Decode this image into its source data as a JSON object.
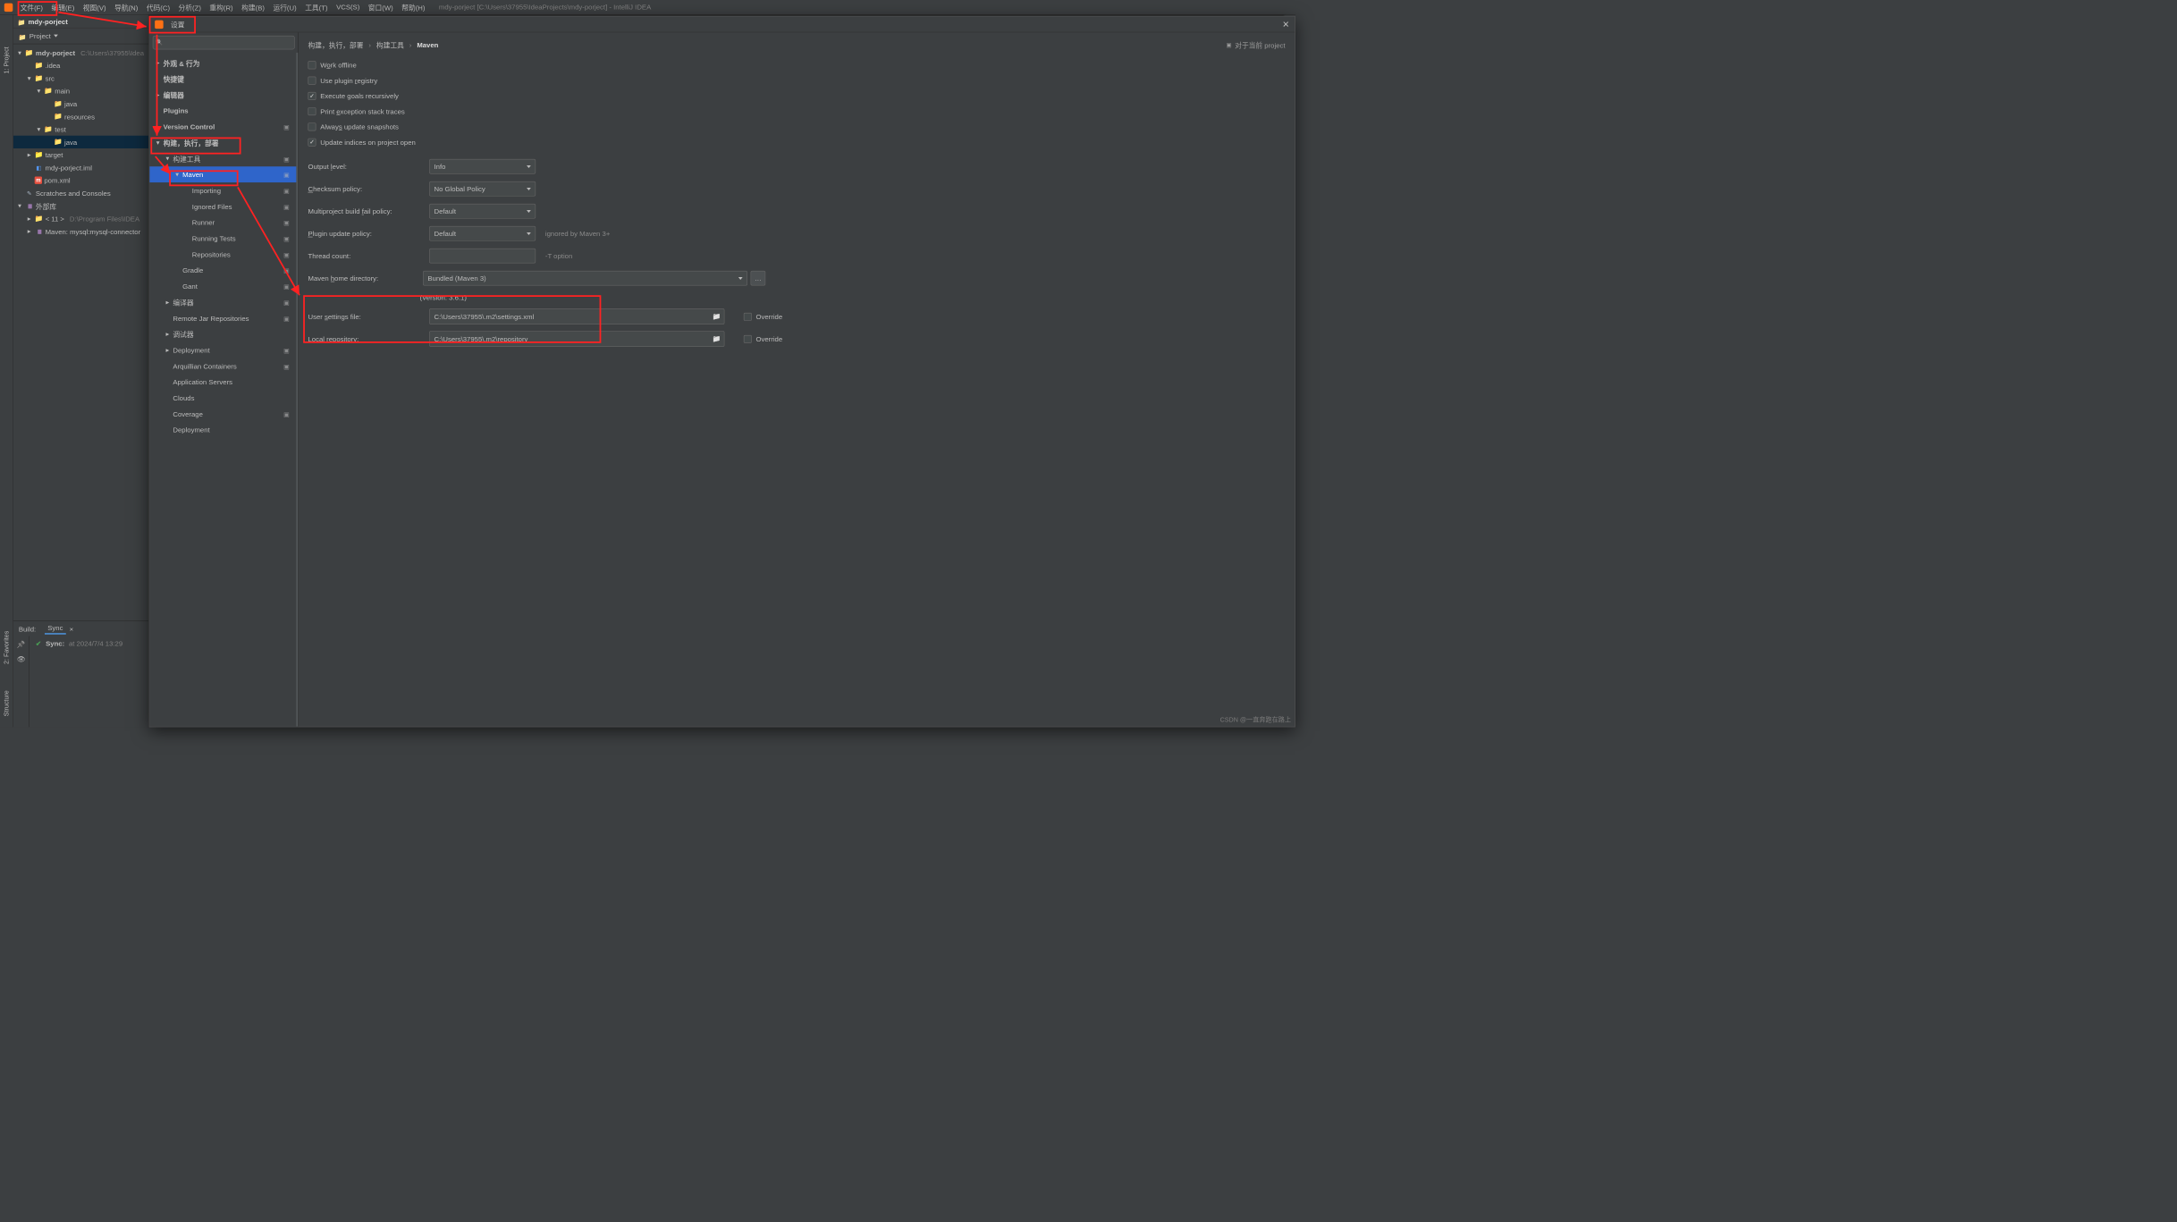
{
  "menubar": {
    "items": [
      "文件(F)",
      "编辑(E)",
      "视图(V)",
      "导航(N)",
      "代码(C)",
      "分析(Z)",
      "重构(R)",
      "构建(B)",
      "运行(U)",
      "工具(T)",
      "VCS(S)",
      "窗口(W)",
      "帮助(H)"
    ],
    "window_title": "mdy-porject [C:\\Users\\37955\\IdeaProjects\\mdy-porject] - IntelliJ IDEA"
  },
  "crumb": {
    "project": "mdy-porject"
  },
  "project_pane": {
    "header": "Project",
    "root_name": "mdy-porject",
    "root_path": "C:\\Users\\37955\\Idea",
    "nodes": [
      {
        "l": ".idea",
        "d": 1,
        "tw": "none",
        "ico": "folder"
      },
      {
        "l": "src",
        "d": 1,
        "tw": "open",
        "ico": "folder"
      },
      {
        "l": "main",
        "d": 2,
        "tw": "open",
        "ico": "folder"
      },
      {
        "l": "java",
        "d": 3,
        "tw": "none",
        "ico": "folder"
      },
      {
        "l": "resources",
        "d": 3,
        "tw": "none",
        "ico": "folder"
      },
      {
        "l": "test",
        "d": 2,
        "tw": "open",
        "ico": "folder"
      },
      {
        "l": "java",
        "d": 3,
        "tw": "none",
        "ico": "folder",
        "sel": true
      },
      {
        "l": "target",
        "d": 1,
        "tw": "closed",
        "ico": "orange-folder"
      },
      {
        "l": "mdy-porject.iml",
        "d": 1,
        "tw": "none",
        "ico": "module"
      },
      {
        "l": "pom.xml",
        "d": 1,
        "tw": "none",
        "ico": "maven"
      }
    ],
    "scratches": "Scratches and Consoles",
    "ext_libs": "外部库",
    "jdk": "< 11 >",
    "jdk_path": "D:\\Program Files\\IDEA",
    "maven_lib": "Maven: mysql:mysql-connector"
  },
  "gutter_left": {
    "project": "1: Project",
    "favorites": "2: Favorites",
    "structure": "Structure"
  },
  "build": {
    "label": "Build:",
    "tab": "Sync",
    "entry": "Sync:",
    "ts": "at 2024/7/4 13:29"
  },
  "dialog": {
    "title": "设置",
    "tree": [
      {
        "l": "外观 & 行为",
        "d": 0,
        "tw": "closed",
        "bold": true
      },
      {
        "l": "快捷键",
        "d": 0,
        "tw": "none",
        "bold": true
      },
      {
        "l": "编辑器",
        "d": 0,
        "tw": "closed",
        "bold": true
      },
      {
        "l": "Plugins",
        "d": 0,
        "tw": "none",
        "bold": true
      },
      {
        "l": "Version Control",
        "d": 0,
        "tw": "closed",
        "bold": true,
        "proj": true
      },
      {
        "l": "构建，执行，部署",
        "d": 0,
        "tw": "open",
        "bold": true
      },
      {
        "l": "构建工具",
        "d": 1,
        "tw": "open",
        "proj": true
      },
      {
        "l": "Maven",
        "d": 2,
        "tw": "open",
        "sel": true,
        "proj": true
      },
      {
        "l": "Importing",
        "d": 3,
        "tw": "none",
        "proj": true
      },
      {
        "l": "Ignored Files",
        "d": 3,
        "tw": "none",
        "proj": true
      },
      {
        "l": "Runner",
        "d": 3,
        "tw": "none",
        "proj": true
      },
      {
        "l": "Running Tests",
        "d": 3,
        "tw": "none",
        "proj": true
      },
      {
        "l": "Repositories",
        "d": 3,
        "tw": "none",
        "proj": true
      },
      {
        "l": "Gradle",
        "d": 2,
        "tw": "none",
        "proj": true
      },
      {
        "l": "Gant",
        "d": 2,
        "tw": "none",
        "proj": true
      },
      {
        "l": "编译器",
        "d": 1,
        "tw": "closed",
        "proj": true
      },
      {
        "l": "Remote Jar Repositories",
        "d": 1,
        "tw": "none",
        "proj": true
      },
      {
        "l": "调试器",
        "d": 1,
        "tw": "closed"
      },
      {
        "l": "Deployment",
        "d": 1,
        "tw": "closed",
        "proj": true
      },
      {
        "l": "Arquillian Containers",
        "d": 1,
        "tw": "none",
        "proj": true
      },
      {
        "l": "Application Servers",
        "d": 1,
        "tw": "none"
      },
      {
        "l": "Clouds",
        "d": 1,
        "tw": "none"
      },
      {
        "l": "Coverage",
        "d": 1,
        "tw": "none",
        "proj": true
      },
      {
        "l": "Deployment",
        "d": 1,
        "tw": "none"
      }
    ],
    "breadcrumb": [
      "构建，执行，部署",
      "构建工具",
      "Maven"
    ],
    "scope": "对于当前 project",
    "checks": [
      {
        "label": "Work offline",
        "checked": false,
        "u": "o"
      },
      {
        "label": "Use plugin registry",
        "checked": false,
        "u": "r"
      },
      {
        "label": "Execute goals recursively",
        "checked": true,
        "u": "g"
      },
      {
        "label": "Print exception stack traces",
        "checked": false,
        "u": "e"
      },
      {
        "label": "Always update snapshots",
        "checked": false,
        "u": "s"
      },
      {
        "label": "Update indices on project open",
        "checked": true
      }
    ],
    "fields": {
      "output_level": {
        "label": "Output level:",
        "value": "Info",
        "u": "l"
      },
      "checksum": {
        "label": "Checksum policy:",
        "value": "No Global Policy",
        "u": "C"
      },
      "multiproj": {
        "label": "Multiproject build fail policy:",
        "value": "Default",
        "u": "f"
      },
      "plugin_update": {
        "label": "Plugin update policy:",
        "value": "Default",
        "hint": "ignored by Maven 3+",
        "u": "P"
      },
      "thread": {
        "label": "Thread count:",
        "value": "",
        "hint": "-T option"
      },
      "home": {
        "label": "Maven home directory:",
        "value": "Bundled (Maven 3)",
        "u": "h"
      },
      "version": "(Version: 3.6.1)",
      "user_settings": {
        "label": "User settings file:",
        "value": "C:\\Users\\37955\\.m2\\settings.xml",
        "override": "Override",
        "u": "s"
      },
      "local_repo": {
        "label": "Local repository:",
        "value": "C:\\Users\\37955\\.m2\\repository",
        "override": "Override",
        "u": "r"
      }
    }
  },
  "watermark": "CSDN @一直奔跑在路上"
}
